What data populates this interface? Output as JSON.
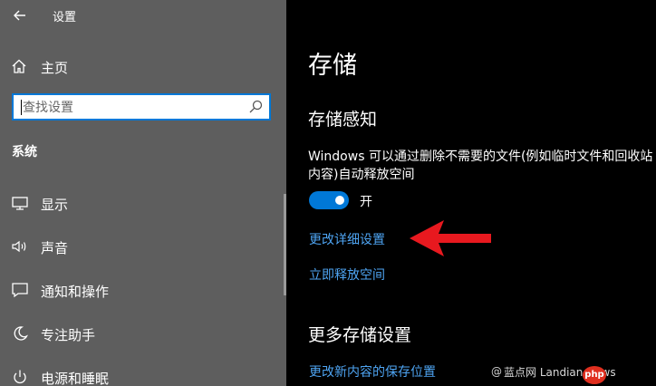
{
  "window": {
    "title": "设置",
    "back_icon": "arrow-left-icon"
  },
  "sidebar": {
    "home": {
      "label": "主页",
      "icon": "home-icon"
    },
    "search": {
      "placeholder": "查找设置",
      "value": "",
      "icon": "search-icon"
    },
    "section_header": "系统",
    "items": [
      {
        "label": "显示",
        "icon": "monitor-icon"
      },
      {
        "label": "声音",
        "icon": "speaker-icon"
      },
      {
        "label": "通知和操作",
        "icon": "message-icon"
      },
      {
        "label": "专注助手",
        "icon": "moon-icon"
      },
      {
        "label": "电源和睡眠",
        "icon": "power-icon"
      }
    ]
  },
  "main": {
    "title": "存储",
    "storage_sense": {
      "heading": "存储感知",
      "description_line1": "Windows 可以通过删除不需要的文件(例如临时文件和回收站",
      "description_line2": "内容)自动释放空间",
      "toggle_state": "开",
      "toggle_on": true,
      "detail_link": "更改详细设置",
      "free_now_link": "立即释放空间"
    },
    "more_storage": {
      "heading": "更多存储设置",
      "new_content_link": "更改新内容的保存位置"
    }
  },
  "annotation": {
    "arrow_color": "#e8191f",
    "arrow_icon": "red-arrow-left"
  },
  "watermark": {
    "at": "@",
    "text": "蓝点网 Landian.News",
    "badge": "php"
  },
  "colors": {
    "sidebar_bg": "#5e5e5e",
    "main_bg": "#000000",
    "accent": "#0078d7",
    "link": "#4ea4f2"
  }
}
